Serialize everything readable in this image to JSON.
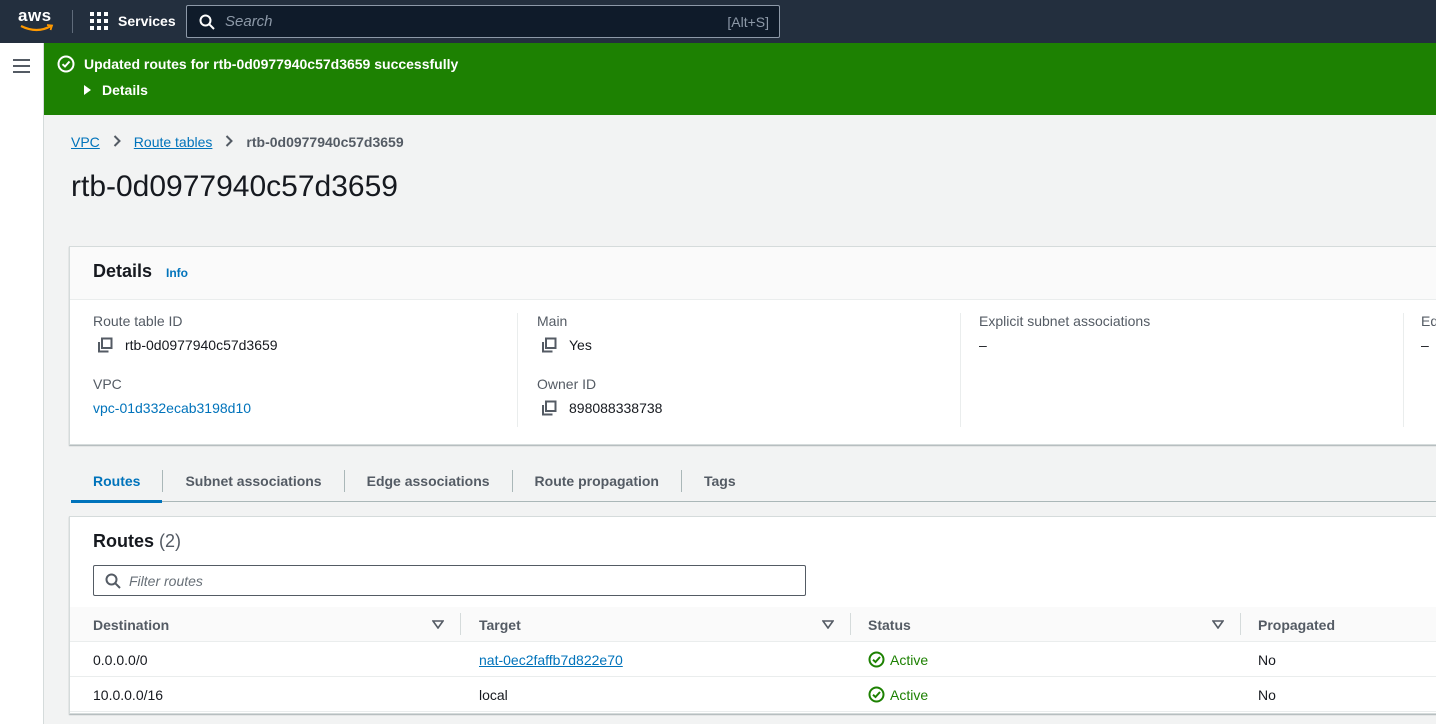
{
  "topnav": {
    "logo": "aws",
    "services_label": "Services",
    "search_placeholder": "Search",
    "search_shortcut": "[Alt+S]"
  },
  "flash": {
    "message": "Updated routes for rtb-0d0977940c57d3659 successfully",
    "details_label": "Details",
    "color": "#1d8102"
  },
  "breadcrumb": {
    "items": [
      "VPC",
      "Route tables"
    ],
    "current": "rtb-0d0977940c57d3659"
  },
  "page_title": "rtb-0d0977940c57d3659",
  "details": {
    "title": "Details",
    "info_label": "Info",
    "fields": {
      "route_table_id_label": "Route table ID",
      "route_table_id": "rtb-0d0977940c57d3659",
      "vpc_label": "VPC",
      "vpc": "vpc-01d332ecab3198d10",
      "main_label": "Main",
      "main": "Yes",
      "owner_label": "Owner ID",
      "owner": "898088338738",
      "explicit_label": "Explicit subnet associations",
      "explicit": "–",
      "edge_label": "Ed",
      "edge": "–"
    }
  },
  "tabs": [
    {
      "label": "Routes",
      "active": true
    },
    {
      "label": "Subnet associations",
      "active": false
    },
    {
      "label": "Edge associations",
      "active": false
    },
    {
      "label": "Route propagation",
      "active": false
    },
    {
      "label": "Tags",
      "active": false
    }
  ],
  "routes": {
    "title": "Routes",
    "count": "(2)",
    "filter_placeholder": "Filter routes",
    "columns": [
      "Destination",
      "Target",
      "Status",
      "Propagated"
    ],
    "rows": [
      {
        "destination": "0.0.0.0/0",
        "target": "nat-0ec2faffb7d822e70",
        "target_link": true,
        "status": "Active",
        "propagated": "No"
      },
      {
        "destination": "10.0.0.0/16",
        "target": "local",
        "target_link": false,
        "status": "Active",
        "propagated": "No"
      }
    ]
  },
  "colors": {
    "nav_bg": "#232f3e",
    "link": "#0073bb",
    "success": "#1d8102"
  }
}
